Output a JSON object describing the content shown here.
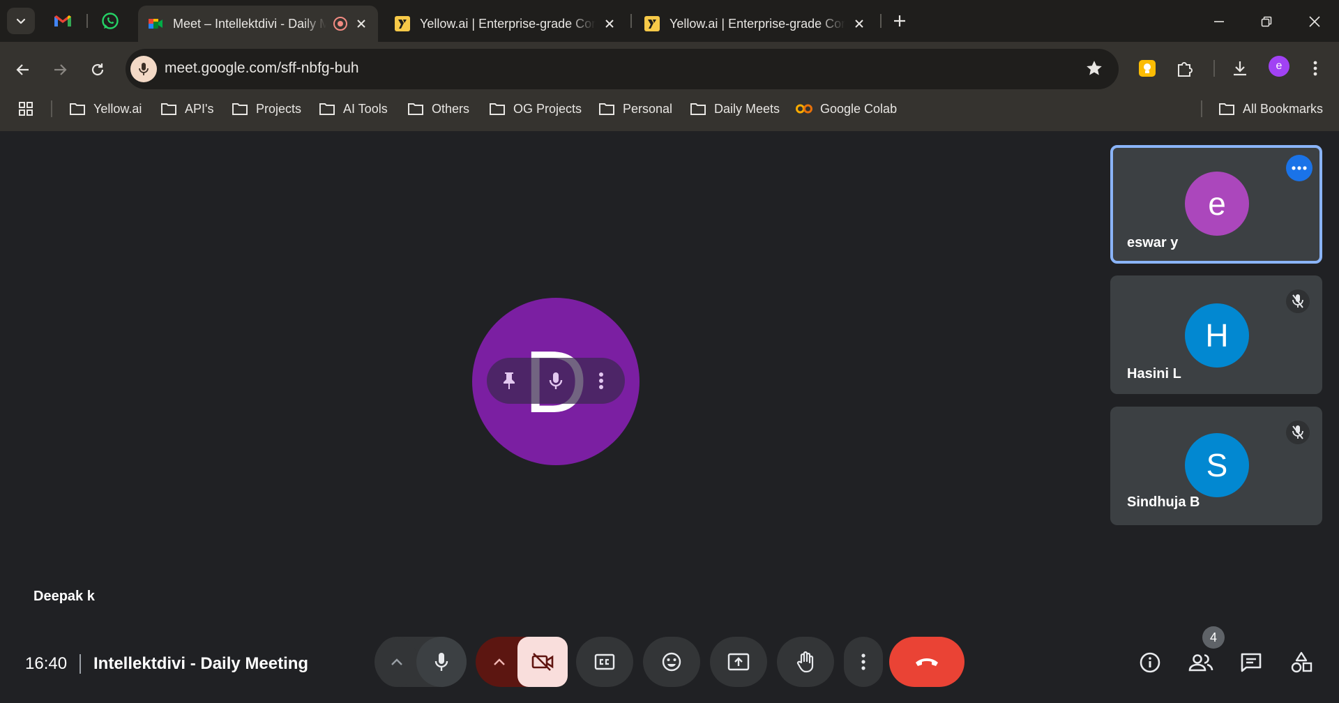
{
  "tabs": [
    {
      "title": "Meet – Intellektdivi - Daily Meeting",
      "active": true
    },
    {
      "title": "Yellow.ai | Enterprise-grade Conversational AI",
      "active": false
    },
    {
      "title": "Yellow.ai | Enterprise-grade Conversational AI",
      "active": false
    }
  ],
  "address": {
    "url": "meet.google.com/sff-nbfg-buh"
  },
  "profile_initial": "e",
  "bookmarks": [
    "Yellow.ai",
    "API's",
    "Projects",
    "AI Tools",
    "Others",
    "OG Projects",
    "Personal",
    "Daily Meets",
    "Google Colab"
  ],
  "all_bookmarks": "All Bookmarks",
  "meet": {
    "main": {
      "initial": "D",
      "name": "Deepak k",
      "avatar_color": "#7b1fa2"
    },
    "tiles": [
      {
        "initial": "e",
        "name": "eswar y",
        "color": "#ab47bc",
        "active": true
      },
      {
        "initial": "H",
        "name": "Hasini L",
        "color": "#0288d1",
        "muted": true
      },
      {
        "initial": "S",
        "name": "Sindhuja B",
        "color": "#0288d1",
        "muted": true
      }
    ],
    "time": "16:40",
    "meeting_title": "Intellektdivi - Daily Meeting",
    "participant_count": "4"
  },
  "colors": {
    "end_call": "#ea4335",
    "camera_off_bg": "#f9dedc",
    "camera_group": "#5c1611",
    "accent": "#8ab4f8"
  }
}
